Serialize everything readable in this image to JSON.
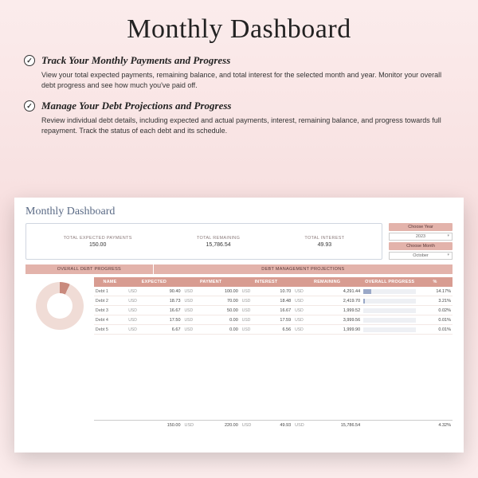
{
  "page_title": "Monthly Dashboard",
  "features": [
    {
      "title": "Track Your Monthly Payments and Progress",
      "desc": "View your total expected payments, remaining balance, and total interest for the selected month and year. Monitor your overall debt progress and see how much you've paid off."
    },
    {
      "title": "Manage Your Debt Projections and Progress",
      "desc": "Review individual debt details, including expected and actual payments, interest, remaining balance, and progress towards full repayment. Track the status of each debt and its schedule."
    }
  ],
  "screenshot": {
    "title": "Monthly Dashboard",
    "summary": {
      "expected_label": "TOTAL EXPECTED PAYMENTS",
      "expected_value": "150.00",
      "remaining_label": "TOTAL REMAINING",
      "remaining_value": "15,786.54",
      "interest_label": "TOTAL INTEREST",
      "interest_value": "49.93"
    },
    "pickers": {
      "year_label": "Choose Year",
      "year_value": "2023",
      "month_label": "Choose Month",
      "month_value": "October"
    },
    "bands": {
      "left": "OVERALL DEBT PROGRESS",
      "right": "DEBT MANAGEMENT PROJECTIONS"
    },
    "columns": [
      "NAME",
      "EXPECTED",
      "PAYMENT",
      "INTEREST",
      "REMAINING",
      "OVERALL PROGRESS",
      "%"
    ],
    "currency": "USD",
    "rows": [
      {
        "name": "Debt 1",
        "expected": "90.40",
        "payment": "100.00",
        "interest": "10.70",
        "remaining": "4,291.44",
        "prog": 14.17,
        "pct": "14.17%"
      },
      {
        "name": "Debt 2",
        "expected": "18.73",
        "payment": "70.00",
        "interest": "18.48",
        "remaining": "2,419.70",
        "prog": 3.21,
        "pct": "3.21%"
      },
      {
        "name": "Debt 3",
        "expected": "16.67",
        "payment": "50.00",
        "interest": "16.67",
        "remaining": "1,999.52",
        "prog": 0.02,
        "pct": "0.02%"
      },
      {
        "name": "Debt 4",
        "expected": "17.50",
        "payment": "0.00",
        "interest": "17.59",
        "remaining": "3,999.56",
        "prog": 0.01,
        "pct": "0.01%"
      },
      {
        "name": "Debt 5",
        "expected": "6.67",
        "payment": "0.00",
        "interest": "6.56",
        "remaining": "1,999.90",
        "prog": 0.01,
        "pct": "0.01%"
      }
    ],
    "totals": {
      "expected": "150.00",
      "payment": "220.00",
      "interest": "49.93",
      "remaining": "15,786.54",
      "pct": "4.32%"
    }
  }
}
